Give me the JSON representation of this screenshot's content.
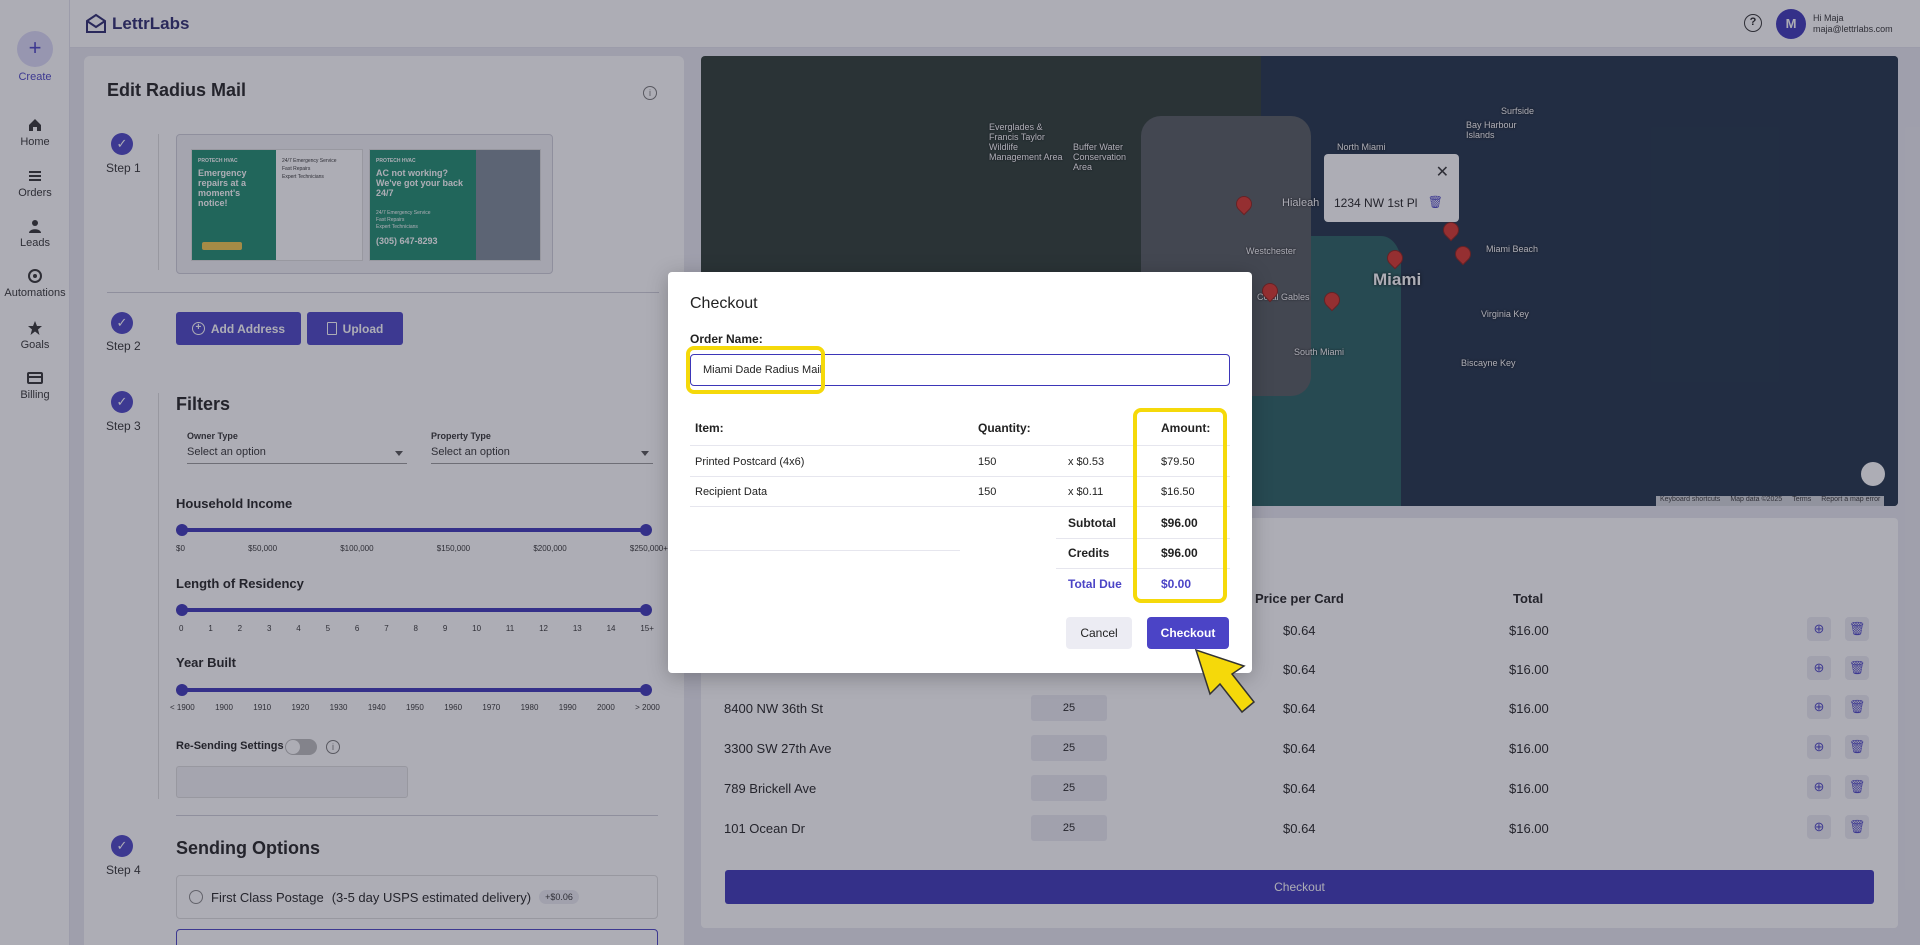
{
  "app": {
    "brand": "LettrLabs",
    "user_greeting": "Hi Maja",
    "user_email": "maja@lettrlabs.com",
    "avatar_initial": "M"
  },
  "sidebar": {
    "create_label": "Create",
    "items": [
      {
        "label": "Home",
        "icon": "home-icon"
      },
      {
        "label": "Orders",
        "icon": "list-icon"
      },
      {
        "label": "Leads",
        "icon": "person-icon"
      },
      {
        "label": "Automations",
        "icon": "automation-icon"
      },
      {
        "label": "Goals",
        "icon": "star-icon"
      },
      {
        "label": "Billing",
        "icon": "card-icon"
      }
    ]
  },
  "editor": {
    "title": "Edit Radius Mail",
    "steps": [
      "Step 1",
      "Step 2",
      "Step 3",
      "Step 4"
    ],
    "postcard_front": {
      "brand": "PROTECH HVAC",
      "headline": "Emergency repairs at a moment's notice!",
      "bullets": [
        "24/7 Emergency Service",
        "Fast Repairs",
        "Expert Technicians"
      ]
    },
    "postcard_back": {
      "brand": "PROTECH HVAC",
      "headline": "AC not working? We've got your back 24/7",
      "bullets": [
        "24/7 Emergency Service",
        "Fast Repairs",
        "Expert Technicians"
      ],
      "phone": "(305) 647-8293"
    },
    "add_address_label": "Add Address",
    "upload_label": "Upload",
    "filters_title": "Filters",
    "owner_type_label": "Owner Type",
    "owner_type_value": "Select an option",
    "property_type_label": "Property Type",
    "property_type_value": "Select an option",
    "household_income_title": "Household Income",
    "household_income_ticks": [
      "$0",
      "$50,000",
      "$100,000",
      "$150,000",
      "$200,000",
      "$250,000+"
    ],
    "residency_title": "Length of Residency",
    "residency_ticks": [
      "0",
      "1",
      "2",
      "3",
      "4",
      "5",
      "6",
      "7",
      "8",
      "9",
      "10",
      "11",
      "12",
      "13",
      "14",
      "15+"
    ],
    "year_built_title": "Year Built",
    "year_built_ticks": [
      "< 1900",
      "1900",
      "1910",
      "1920",
      "1930",
      "1940",
      "1950",
      "1960",
      "1970",
      "1980",
      "1990",
      "2000",
      "> 2000"
    ],
    "resend_label": "Re-Sending Settings",
    "sending_options_title": "Sending Options",
    "postage_option": "First Class Postage",
    "postage_detail": "(3-5 day USPS estimated delivery)",
    "postage_badge": "+$0.06"
  },
  "map": {
    "labels": [
      "Everglades & Francis Taylor Wildlife Management Area",
      "Buffer Water Conservation Area",
      "Hialeah",
      "Miami",
      "Virginia Key",
      "Biscayne Key",
      "South Miami",
      "Coral Gables",
      "Westchester",
      "North Miami",
      "Miami Beach",
      "Bay Harbour Islands",
      "Surfside"
    ],
    "city": "Miami",
    "popup_address": "1234 NW 1st Pl",
    "footer": [
      "Keyboard shortcuts",
      "Map data ©2025",
      "Terms",
      "Report a map error"
    ]
  },
  "addresses_table": {
    "headers": {
      "price": "Price per Card",
      "total": "Total"
    },
    "rows": [
      {
        "address": "",
        "qty": "",
        "price": "$0.64",
        "total": "$16.00"
      },
      {
        "address": "",
        "qty": "",
        "price": "$0.64",
        "total": "$16.00"
      },
      {
        "address": "8400 NW 36th St",
        "qty": "25",
        "price": "$0.64",
        "total": "$16.00"
      },
      {
        "address": "3300 SW 27th Ave",
        "qty": "25",
        "price": "$0.64",
        "total": "$16.00"
      },
      {
        "address": "789 Brickell Ave",
        "qty": "25",
        "price": "$0.64",
        "total": "$16.00"
      },
      {
        "address": "101 Ocean Dr",
        "qty": "25",
        "price": "$0.64",
        "total": "$16.00"
      }
    ],
    "checkout_label": "Checkout"
  },
  "checkout_modal": {
    "title": "Checkout",
    "order_name_label": "Order Name:",
    "order_name_value": "Miami Dade Radius Mail",
    "headers": {
      "item": "Item:",
      "quantity": "Quantity:",
      "amount": "Amount:"
    },
    "line_items": [
      {
        "item": "Printed Postcard (4x6)",
        "quantity": "150",
        "unit": "x $0.53",
        "amount": "$79.50"
      },
      {
        "item": "Recipient Data",
        "quantity": "150",
        "unit": "x $0.11",
        "amount": "$16.50"
      }
    ],
    "subtotal_label": "Subtotal",
    "subtotal_value": "$96.00",
    "credits_label": "Credits",
    "credits_value": "$96.00",
    "total_due_label": "Total Due",
    "total_due_value": "$0.00",
    "cancel_label": "Cancel",
    "checkout_label": "Checkout"
  },
  "colors": {
    "accent": "#4b44c6",
    "highlight": "#f5d90a"
  }
}
